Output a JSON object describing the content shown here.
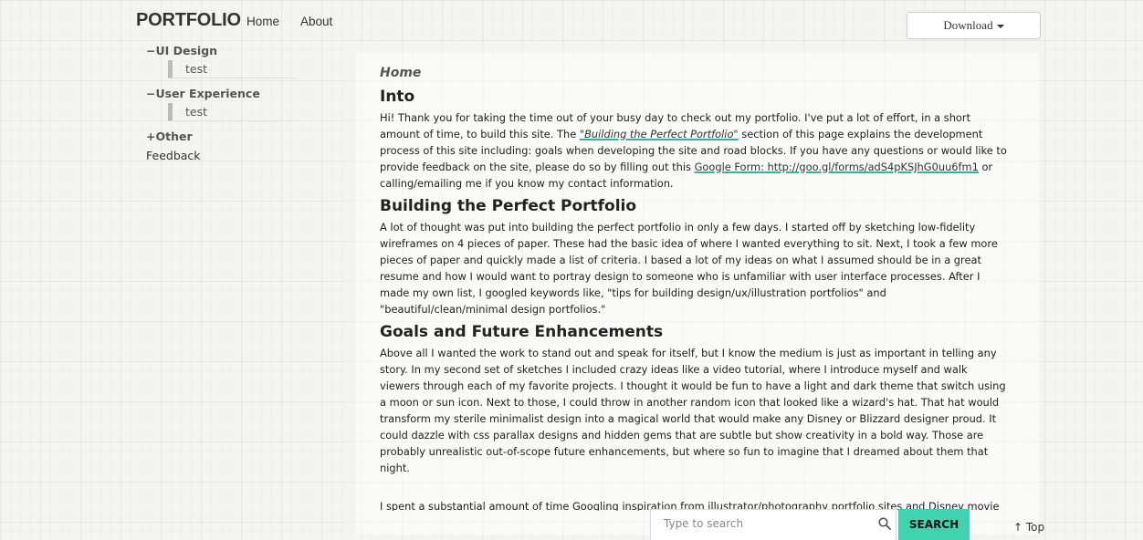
{
  "header": {
    "brand": "PORTFOLIO",
    "nav": [
      "Home",
      "About"
    ],
    "download_label": "Download"
  },
  "sidebar": {
    "groups": [
      {
        "label": "−UI Design",
        "sub": "test"
      },
      {
        "label": "−User Experience",
        "sub": "test"
      },
      {
        "label": "+Other"
      }
    ],
    "feedback": "Feedback"
  },
  "content": {
    "breadcrumb": "Home",
    "sections": [
      {
        "heading": "Into",
        "p_before": "Hi! Thank you for taking the time out of your busy day to check out my portfolio. I've put a lot of effort, in a short amount of time, to build this site. The ",
        "link1": "\"Building the Perfect Portfolio\"",
        "p_mid": " section of this page explains the development process of this site including: goals when developing the site and road blocks. If you have any questions or would like to provide feedback on the site, please do so by filling out this ",
        "link2": "Google Form: http://goo.gl/forms/adS4pKSJhG0uu6fm1",
        "p_after": " or calling/emailing me if you know my contact information."
      },
      {
        "heading": "Building the Perfect Portfolio",
        "text": "A lot of thought was put into building the perfect portfolio in only a few days. I started off by sketching low-fidelity wireframes on 4 pieces of paper. These had the basic idea of where I wanted everything to sit. Next, I took a few more pieces of paper and quickly made a list of criteria. I based a lot of my ideas on what I assumed should be in a great resume and how I would want to portray design to someone who is unfamiliar with user interface processes. After I made my own list, I googled keywords like, \"tips for building design/ux/illustration portfolios\" and \"beautiful/clean/minimal design portfolios.\""
      },
      {
        "heading": "Goals and Future Enhancements",
        "text": "Above all I wanted the work to stand out and speak for itself, but I know the medium is just as important in telling any story. In my second set of sketches I included crazy ideas like a video tutorial, where I introduce myself and walk viewers through each of my favorite projects. I thought it would be fun to have a light and dark theme that switch using a moon or sun icon. Next to those, I could throw in another random icon that looked like a wizard's hat. That hat would transform my sterile minimalist design into a magical world that would make any Disney or Blizzard designer proud. It could dazzle with css parallax designs and hidden gems that are subtle but show creativity in a bold way. Those are probably unrealistic out-of-scope future enhancements, but where so fun to imagine that I dreamed about them that night."
      }
    ],
    "cut_text": "I spent a substantial amount of time Googling inspiration from illustrator/photography portfolio sites and Disney movie"
  },
  "footer": {
    "search_placeholder": "Type to search",
    "search_button": "SEARCH",
    "top_link": "↑ Top"
  },
  "colors": {
    "accent": "#3fd3b0"
  }
}
